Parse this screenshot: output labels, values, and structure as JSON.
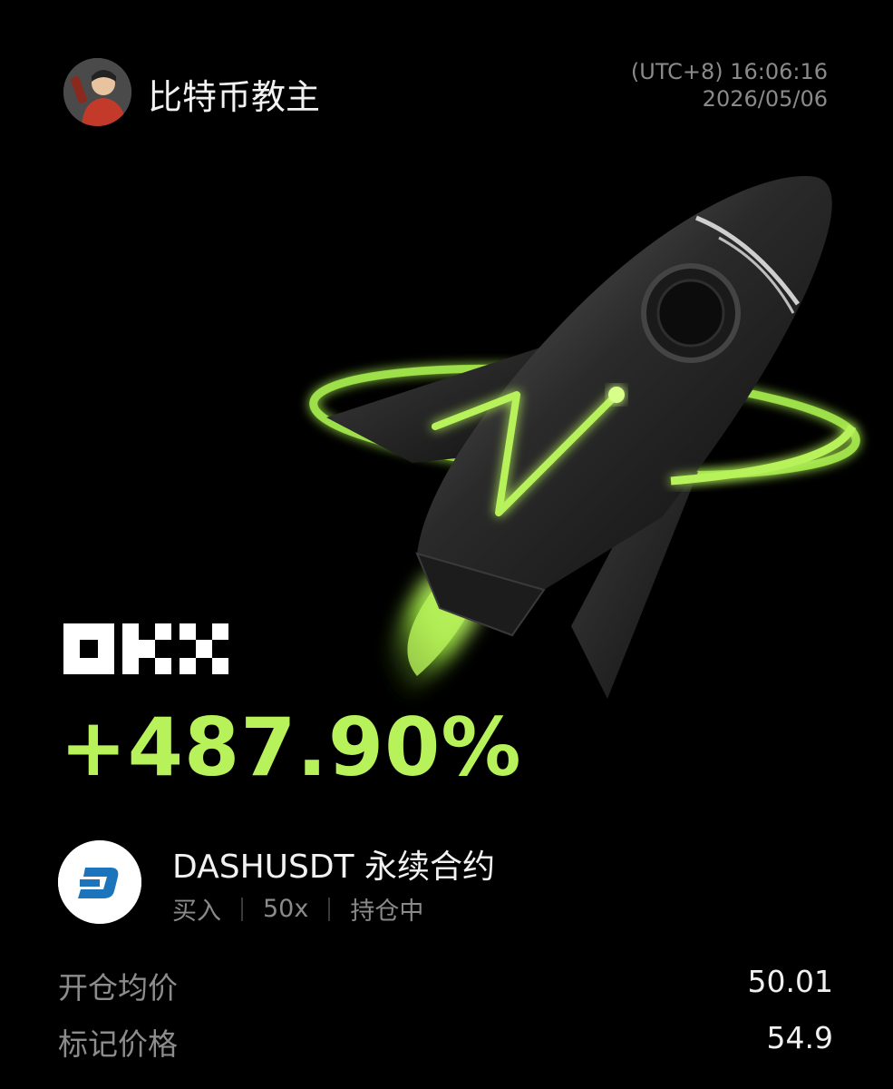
{
  "user": {
    "name": "比特币教主",
    "avatar_icon": "user-avatar"
  },
  "timestamp": {
    "timezone_time": "(UTC+8) 16:06:16",
    "date": "2026/05/06"
  },
  "brand": {
    "logo": "OKX",
    "accent_color": "#b8f25a"
  },
  "pnl": {
    "percent": "+487.90%"
  },
  "instrument": {
    "title": "DASHUSDT 永续合约",
    "icon": "dash-coin-icon",
    "side": "买入",
    "leverage": "50x",
    "status": "持仓中"
  },
  "prices": [
    {
      "label": "开仓均价",
      "value": "50.01"
    },
    {
      "label": "标记价格",
      "value": "54.9"
    }
  ]
}
